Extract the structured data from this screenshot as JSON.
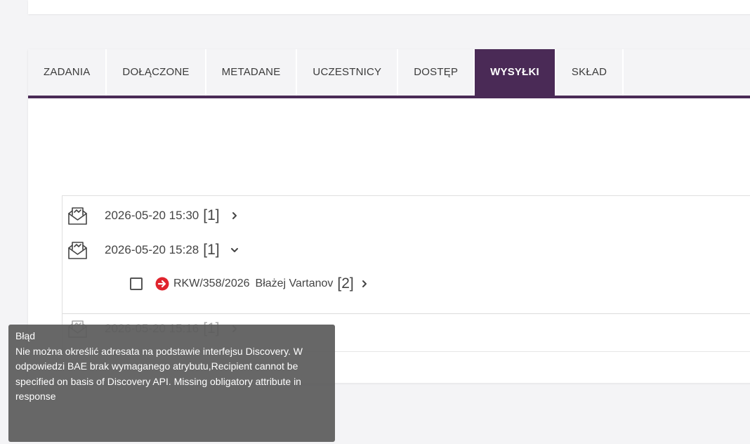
{
  "tabs": [
    {
      "label": "ZADANIA",
      "active": false
    },
    {
      "label": "DOŁĄCZONE",
      "active": false
    },
    {
      "label": "METADANE",
      "active": false
    },
    {
      "label": "UCZESTNICY",
      "active": false
    },
    {
      "label": "DOSTĘP",
      "active": false
    },
    {
      "label": "WYSYŁKI",
      "active": true
    },
    {
      "label": "SKŁAD",
      "active": false
    }
  ],
  "shipments": [
    {
      "date": "2026-05-20 15:30",
      "count": "[1]",
      "expanded": false
    },
    {
      "date": "2026-05-20 15:28",
      "count": "[1]",
      "expanded": true,
      "items": [
        {
          "number": "RKW/358/2026",
          "recipient": "Błażej Vartanov",
          "count": "[2]",
          "status": "error"
        }
      ]
    },
    {
      "date": "2026-05-20 15:16",
      "count": "[1]",
      "expanded": false
    }
  ],
  "tooltip": {
    "title": "Błąd",
    "text": "Nie można określić adresata na podstawie interfejsu Discovery. W odpowiedzi BAE brak wymaganego atrybutu,Recipient cannot be specified on basis of Discovery API. Missing obligatory attribute in response"
  },
  "colors": {
    "accent": "#4a2a56",
    "error": "#e0242d",
    "tooltip_bg": "#5a5a5a"
  },
  "icons": {
    "shipment": "envelope-send-icon",
    "expand": "chevron-right-icon",
    "collapse": "chevron-down-icon",
    "error": "error-arrow-icon"
  }
}
